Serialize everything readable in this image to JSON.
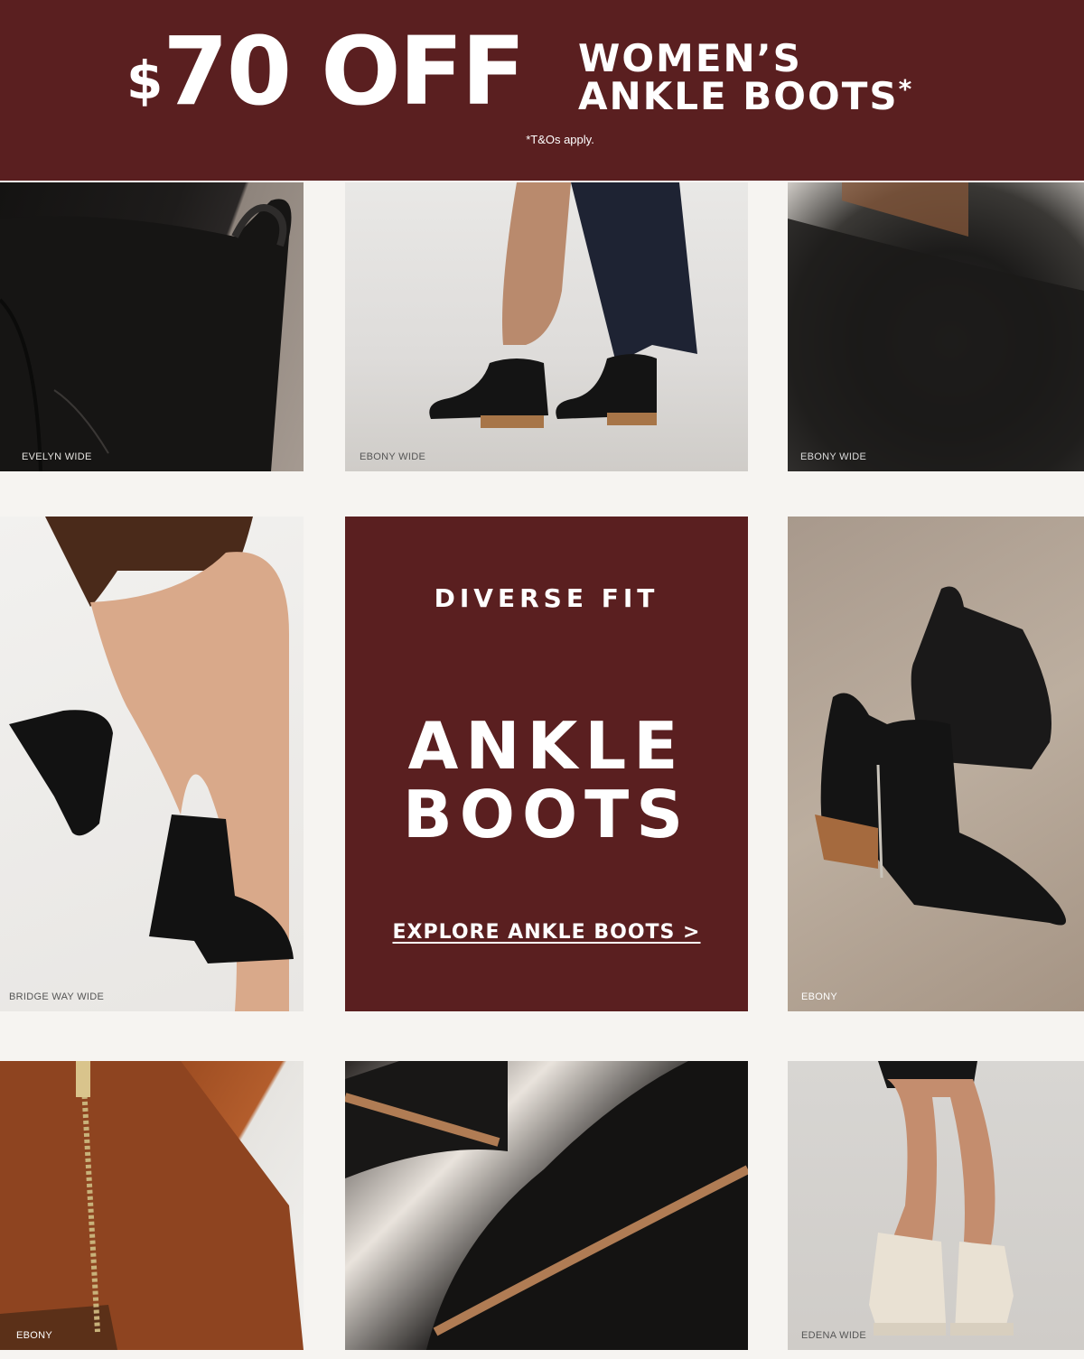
{
  "banner": {
    "dollar": "$",
    "amount": "70 OFF",
    "line1": "WOMEN’S",
    "line2": "ANKLE BOOTS",
    "asterisk": "*",
    "terms": "*T&Os apply."
  },
  "tiles": [
    {
      "caption": "EVELYN WIDE"
    },
    {
      "caption": "EBONY WIDE"
    },
    {
      "caption": "EBONY WIDE"
    },
    {
      "caption": "BRIDGE WAY WIDE"
    },
    {
      "caption": "EBONY"
    },
    {
      "caption": "EBONY"
    },
    {
      "caption": "EDENA WIDE"
    }
  ],
  "promo": {
    "kicker": "DIVERSE FIT",
    "title_line1": "ANKLE",
    "title_line2": "BOOTS",
    "cta": "EXPLORE ANKLE BOOTS >"
  },
  "colors": {
    "brand_burgundy": "#5a1f20",
    "page_bg": "#f6f4f1"
  }
}
